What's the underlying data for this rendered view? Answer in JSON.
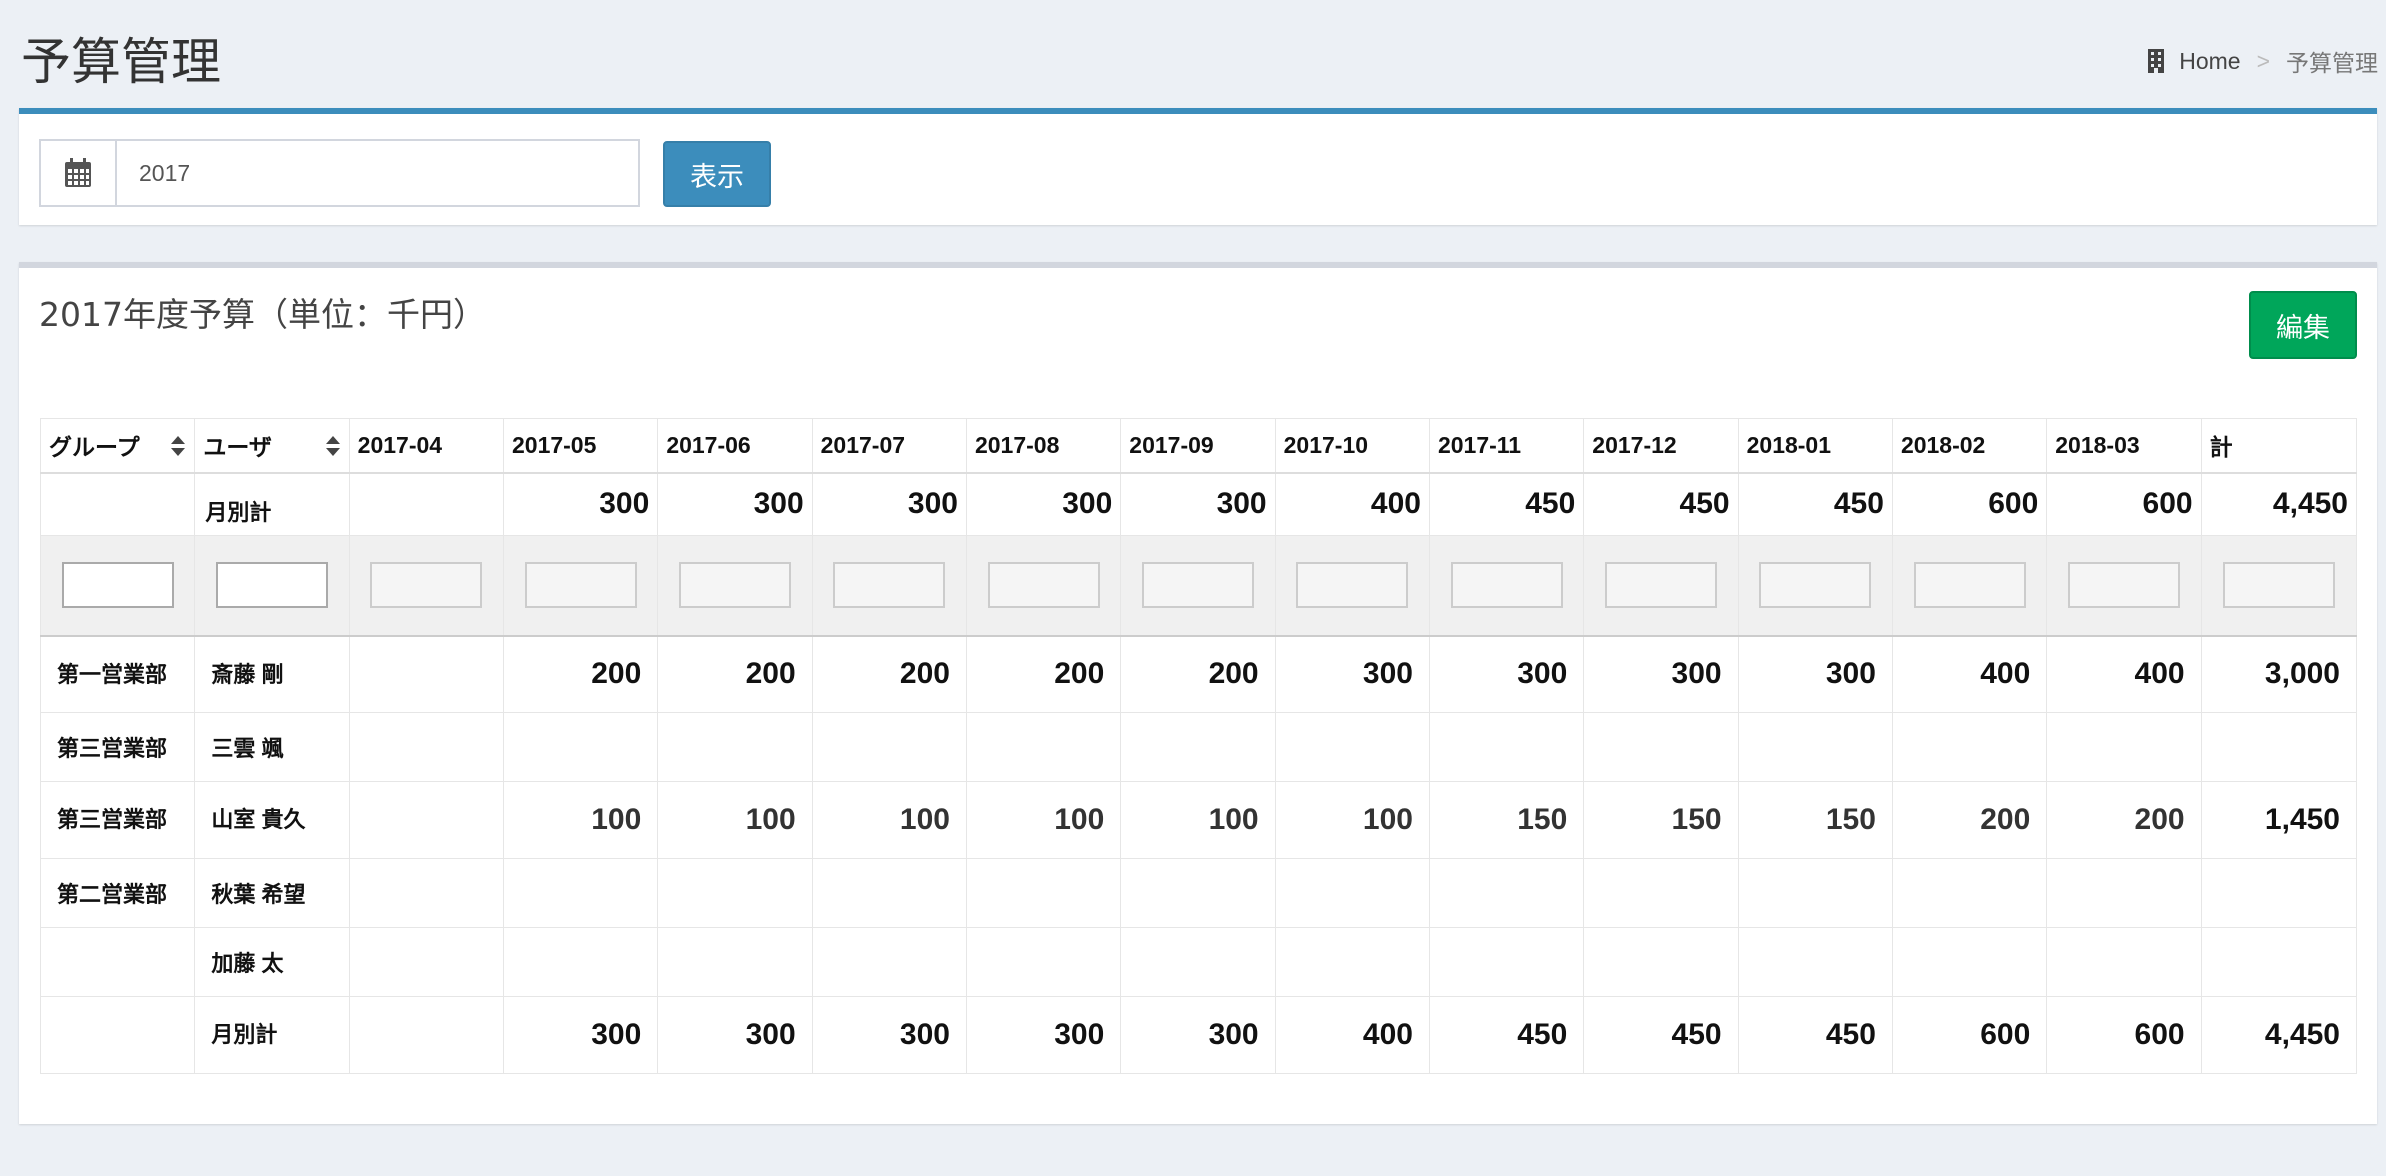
{
  "page": {
    "title": "予算管理"
  },
  "breadcrumb": {
    "home": "Home",
    "separator": ">",
    "current": "予算管理"
  },
  "filter": {
    "year_value": "2017",
    "show_label": "表示"
  },
  "budget": {
    "title": "2017年度予算（単位：千円）",
    "edit_label": "編集",
    "headers": {
      "group": "グループ",
      "user": "ユーザ",
      "months": [
        "2017-04",
        "2017-05",
        "2017-06",
        "2017-07",
        "2017-08",
        "2017-09",
        "2017-10",
        "2017-11",
        "2017-12",
        "2018-01",
        "2018-02",
        "2018-03"
      ],
      "total": "計"
    },
    "top_total": {
      "label": "月別計",
      "values": [
        "",
        "300",
        "300",
        "300",
        "300",
        "300",
        "400",
        "450",
        "450",
        "450",
        "600",
        "600"
      ],
      "total": "4,450"
    },
    "rows": [
      {
        "group": "第一営業部",
        "user": "斎藤 剛",
        "values": [
          "",
          "200",
          "200",
          "200",
          "200",
          "200",
          "300",
          "300",
          "300",
          "300",
          "400",
          "400"
        ],
        "total": "3,000"
      },
      {
        "group": "第三営業部",
        "user": "三雲 颯",
        "values": [
          "",
          "",
          "",
          "",
          "",
          "",
          "",
          "",
          "",
          "",
          "",
          ""
        ],
        "total": ""
      },
      {
        "group": "第三営業部",
        "user": "山室 貴久",
        "values": [
          "",
          "100",
          "100",
          "100",
          "100",
          "100",
          "100",
          "150",
          "150",
          "150",
          "200",
          "200"
        ],
        "total": "1,450"
      },
      {
        "group": "第二営業部",
        "user": "秋葉 希望",
        "values": [
          "",
          "",
          "",
          "",
          "",
          "",
          "",
          "",
          "",
          "",
          "",
          ""
        ],
        "total": ""
      },
      {
        "group": "",
        "user": "加藤 太",
        "values": [
          "",
          "",
          "",
          "",
          "",
          "",
          "",
          "",
          "",
          "",
          "",
          ""
        ],
        "total": ""
      }
    ],
    "bottom_total": {
      "label": "月別計",
      "values": [
        "",
        "300",
        "300",
        "300",
        "300",
        "300",
        "400",
        "450",
        "450",
        "450",
        "600",
        "600"
      ],
      "total": "4,450"
    }
  },
  "colors": {
    "primary": "#3c8dbc",
    "success": "#00a65a",
    "background": "#ecf0f5"
  },
  "icons": {
    "breadcrumb": "building-icon",
    "date": "calendar-icon",
    "sort": "sort-icon"
  }
}
